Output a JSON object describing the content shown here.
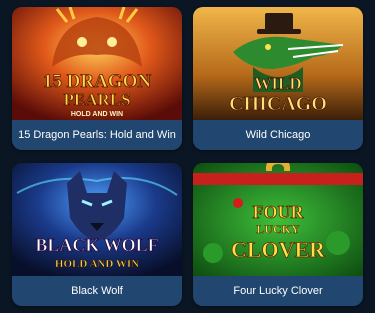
{
  "games": [
    {
      "caption": "15 Dragon Pearls: Hold and Win",
      "art": {
        "line1": "15 DRAGON",
        "line2": "PEARLS",
        "line3": "HOLD AND WIN"
      }
    },
    {
      "caption": "Wild Chicago",
      "art": {
        "line1": "WILD",
        "line2": "CHICAGO"
      }
    },
    {
      "caption": "Black Wolf",
      "art": {
        "line1": "BLACK WOLF",
        "line2": "HOLD AND WIN"
      }
    },
    {
      "caption": "Four Lucky Clover",
      "art": {
        "line1": "FOUR",
        "line2": "LUCKY",
        "line3": "CLOVER"
      }
    }
  ],
  "colors": {
    "background": "#0b1624",
    "caption_bg": "#21466f",
    "caption_text": "#ffffff"
  }
}
